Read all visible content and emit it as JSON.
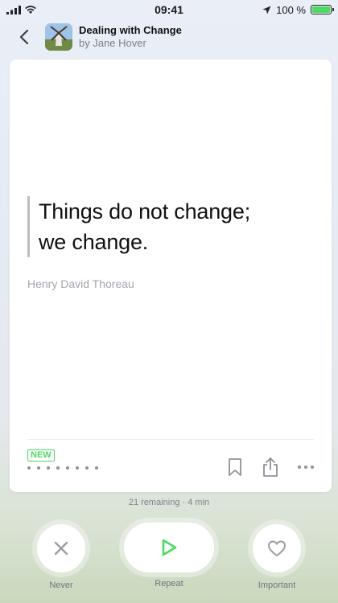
{
  "status_bar": {
    "time": "09:41",
    "battery": "100 %",
    "battery_level": 1.0
  },
  "header": {
    "title": "Dealing with Change",
    "author": "by Jane Hover"
  },
  "card": {
    "quote_line1": "Things do not change;",
    "quote_line2": "we change.",
    "quote_author": "Henry David Thoreau",
    "badge": "NEW",
    "progress_dots": 8
  },
  "remaining": "21 remaining · 4 min",
  "controls": {
    "never_label": "Never",
    "repeat_label": "Repeat",
    "important_label": "Important"
  },
  "colors": {
    "accent": "#4cd964",
    "icon_gray": "#8e9297"
  },
  "icons": [
    "back-icon",
    "bookmark-icon",
    "share-icon",
    "more-icon",
    "close-icon",
    "play-icon",
    "heart-icon"
  ]
}
